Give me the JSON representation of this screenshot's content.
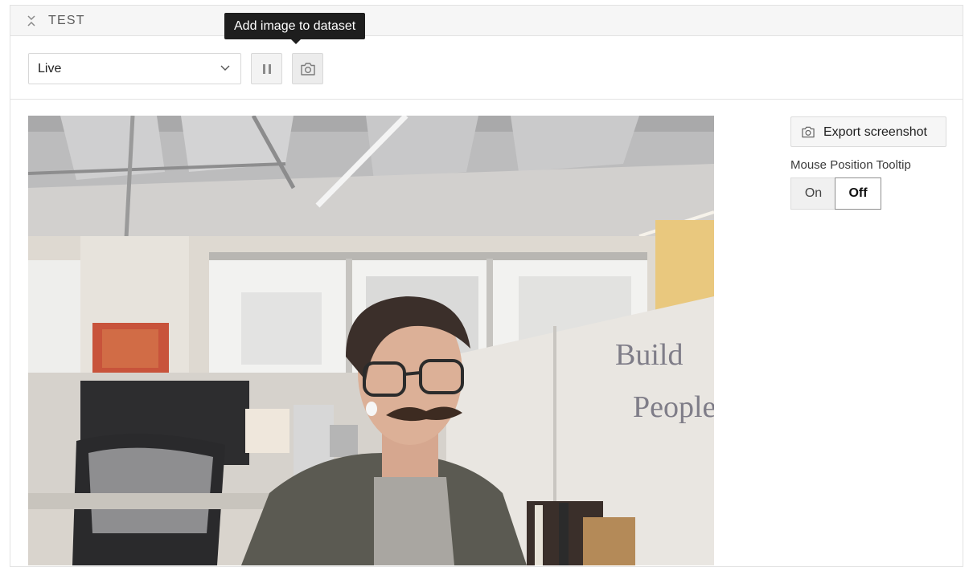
{
  "panel": {
    "title": "TEST"
  },
  "toolbar": {
    "stream_select_value": "Live",
    "tooltip": "Add image to dataset"
  },
  "sidebar": {
    "export_label": "Export screenshot",
    "mouse_tooltip_label": "Mouse Position Tooltip",
    "toggle_on": "On",
    "toggle_off": "Off",
    "toggle_selected": "Off"
  },
  "image": {
    "whiteboard_text_1": "Build",
    "whiteboard_text_2": "People"
  },
  "icons": [
    "collapse-icon",
    "chevron-down-icon",
    "pause-icon",
    "camera-icon"
  ],
  "colors": {
    "header_bg": "#f6f6f6",
    "tooltip_bg": "#1e1e1e",
    "border": "#e2e2e2"
  }
}
